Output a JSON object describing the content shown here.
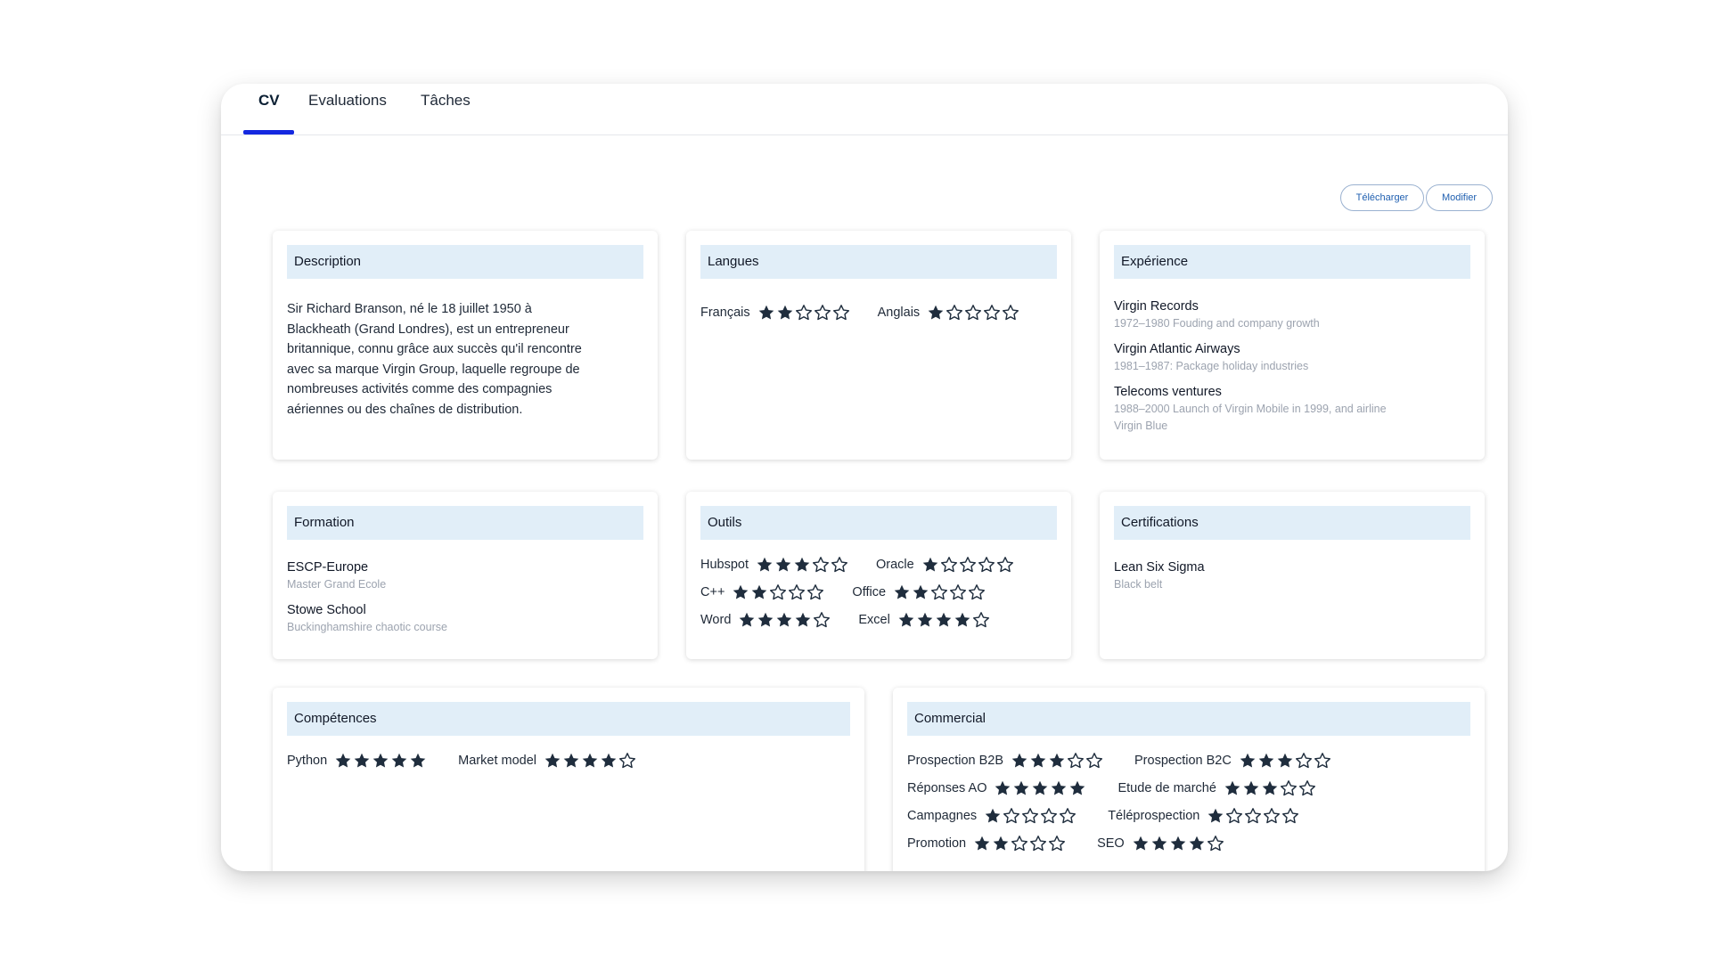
{
  "tabs": [
    {
      "label": "CV",
      "active": true
    },
    {
      "label": "Evaluations",
      "active": false
    },
    {
      "label": "Tâches",
      "active": false
    }
  ],
  "actions": {
    "download_label": "Télécharger",
    "edit_label": "Modifier"
  },
  "colors": {
    "accent": "#1428e0",
    "header_bg": "#e1eef8",
    "star": "#1f2d3d"
  },
  "description": {
    "title": "Description",
    "lines": [
      "Sir Richard Branson, né le 18 juillet 1950 à",
      "Blackheath (Grand Londres), est un entrepreneur",
      "britannique, connu grâce aux succès qu'il rencontre",
      "avec sa marque Virgin Group, laquelle regroupe de",
      "nombreuses activités comme des compagnies",
      "aériennes ou des chaînes de distribution."
    ]
  },
  "langues": {
    "title": "Langues",
    "rows": [
      [
        {
          "name": "Français",
          "rating": 2
        },
        {
          "name": "Anglais",
          "rating": 1
        }
      ]
    ]
  },
  "experience": {
    "title": "Expérience",
    "items": [
      {
        "title": "Virgin Records",
        "lines": [
          "1972–1980 Fouding and company growth"
        ]
      },
      {
        "title": "Virgin Atlantic Airways",
        "lines": [
          "1981–1987: Package holiday industries"
        ]
      },
      {
        "title": "Telecoms ventures",
        "lines": [
          "1988–2000 Launch of Virgin Mobile in 1999, and airline",
          "Virgin Blue"
        ]
      }
    ]
  },
  "formation": {
    "title": "Formation",
    "items": [
      {
        "title": "ESCP-Europe",
        "lines": [
          "Master Grand Ecole"
        ]
      },
      {
        "title": "Stowe School",
        "lines": [
          "Buckinghamshire chaotic course"
        ]
      }
    ]
  },
  "outils": {
    "title": "Outils",
    "rows": [
      [
        {
          "name": "Hubspot",
          "rating": 3
        },
        {
          "name": "Oracle",
          "rating": 1
        }
      ],
      [
        {
          "name": "C++",
          "rating": 2
        },
        {
          "name": "Office",
          "rating": 2
        }
      ],
      [
        {
          "name": "Word",
          "rating": 4
        },
        {
          "name": "Excel",
          "rating": 4
        }
      ]
    ]
  },
  "certifications": {
    "title": "Certifications",
    "items": [
      {
        "title": "Lean Six Sigma",
        "lines": [
          "Black belt"
        ]
      }
    ]
  },
  "competences": {
    "title": "Compétences",
    "rows": [
      [
        {
          "name": "Python",
          "rating": 5
        },
        {
          "name": "Market model",
          "rating": 4
        }
      ]
    ]
  },
  "commercial": {
    "title": "Commercial",
    "rows": [
      [
        {
          "name": "Prospection B2B",
          "rating": 3
        },
        {
          "name": "Prospection B2C",
          "rating": 3
        }
      ],
      [
        {
          "name": "Réponses AO",
          "rating": 5
        },
        {
          "name": "Etude de marché",
          "rating": 3
        }
      ],
      [
        {
          "name": "Campagnes",
          "rating": 1
        },
        {
          "name": "Téléprospection",
          "rating": 1
        }
      ],
      [
        {
          "name": "Promotion",
          "rating": 2
        },
        {
          "name": "SEO",
          "rating": 4
        }
      ]
    ]
  }
}
